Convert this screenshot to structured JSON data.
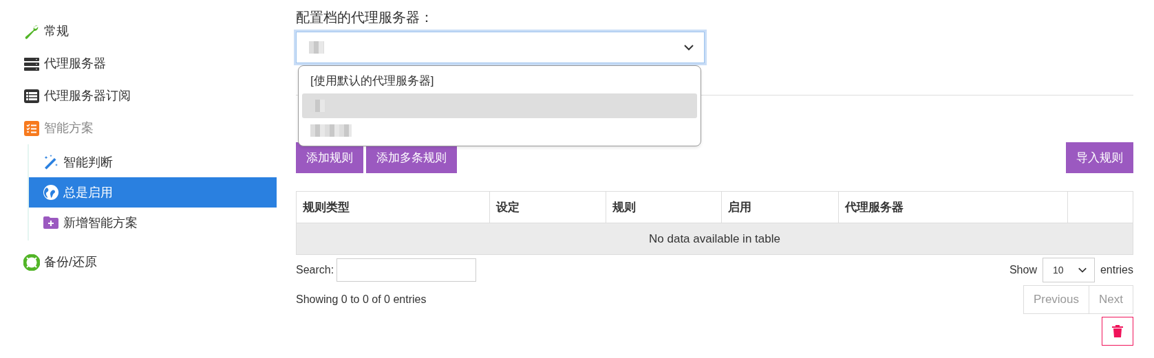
{
  "sidebar": {
    "items": [
      {
        "label": "常规",
        "kind": "general",
        "muted": false
      },
      {
        "label": "代理服务器",
        "kind": "servers",
        "muted": false
      },
      {
        "label": "代理服务器订阅",
        "kind": "subscriptions",
        "muted": false
      },
      {
        "label": "智能方案",
        "kind": "profiles",
        "muted": true,
        "children": [
          {
            "label": "智能判断",
            "kind": "auto",
            "selected": false
          },
          {
            "label": "总是启用",
            "kind": "always",
            "selected": true
          },
          {
            "label": "新增智能方案",
            "kind": "new",
            "selected": false
          }
        ]
      },
      {
        "label": "备份/还原",
        "kind": "backup",
        "muted": false
      }
    ]
  },
  "proxy_select": {
    "label": "配置档的代理服务器：",
    "expanded": true,
    "options": [
      {
        "kind": "text",
        "label": "[使用默认的代理服务器]",
        "selected": false
      },
      {
        "kind": "redacted",
        "selected": true
      },
      {
        "kind": "redacted",
        "selected": false
      }
    ]
  },
  "left_buttons": [
    "添加规则",
    "添加多条规则"
  ],
  "right_buttons": [
    "导入规则"
  ],
  "table": {
    "columns": [
      "规则类型",
      "设定",
      "规则",
      "启用",
      "代理服务器"
    ],
    "empty_text": "No data available in table"
  },
  "search": {
    "label": "Search:"
  },
  "length": {
    "before": "Show",
    "value": "10",
    "after": "entries"
  },
  "info": "Showing 0 to 0 of 0 entries",
  "pagination": [
    {
      "label": "Previous",
      "disabled": true
    },
    {
      "label": "Next",
      "disabled": true
    }
  ]
}
